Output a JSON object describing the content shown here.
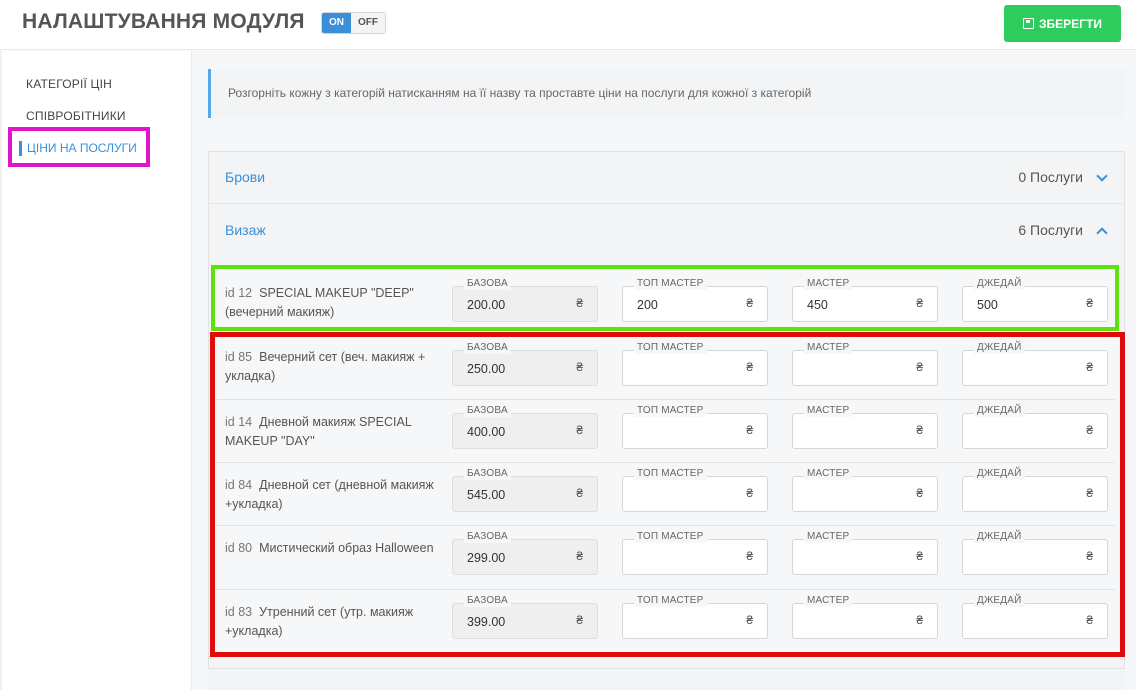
{
  "header": {
    "title": "НАЛАШТУВАННЯ МОДУЛЯ",
    "toggle_on": "ON",
    "toggle_off": "OFF",
    "save_label": "ЗБЕРЕГТИ"
  },
  "sidebar": {
    "items": [
      {
        "label": "КАТЕГОРІЇ ЦІН"
      },
      {
        "label": "СПІВРОБІТНИКИ"
      },
      {
        "label": "ЦІНИ НА ПОСЛУГИ",
        "active": true
      }
    ]
  },
  "info": "Розгорніть кожну з категорій натисканням на її назву та проставте ціни на послуги для кожної з категорій",
  "categories": [
    {
      "name": "Брови",
      "count": "0 Послуги",
      "expanded": false
    },
    {
      "name": "Визаж",
      "count": "6 Послуги",
      "expanded": true
    }
  ],
  "labels": {
    "base": "БАЗОВА",
    "top_master": "ТОП МАСТЕР",
    "master": "МАСТЕР",
    "jedi": "ДЖЕДАЙ",
    "currency": "₴"
  },
  "services": [
    {
      "id": "id 12",
      "name": "SPECIAL MAKEUP \"DEEP\" (вечерний макияж)",
      "base": "200.00",
      "top_master": "200",
      "master": "450",
      "jedi": "500"
    },
    {
      "id": "id 85",
      "name": "Вечерний сет (веч. макияж + укладка)",
      "base": "250.00",
      "top_master": "",
      "master": "",
      "jedi": ""
    },
    {
      "id": "id 14",
      "name": "Дневной макияж SPECIAL MAKEUP \"DAY\"",
      "base": "400.00",
      "top_master": "",
      "master": "",
      "jedi": ""
    },
    {
      "id": "id 84",
      "name": "Дневной сет (дневной макияж +укладка)",
      "base": "545.00",
      "top_master": "",
      "master": "",
      "jedi": ""
    },
    {
      "id": "id 80",
      "name": "Мистический образ Halloween",
      "base": "299.00",
      "top_master": "",
      "master": "",
      "jedi": ""
    },
    {
      "id": "id 83",
      "name": "Утренний сет (утр. макияж +укладка)",
      "base": "399.00",
      "top_master": "",
      "master": "",
      "jedi": ""
    }
  ],
  "colors": {
    "accent": "#3b8fd8",
    "save": "#2ecc5d",
    "highlight_magenta": "#e015c9",
    "highlight_green": "#5ee20f",
    "highlight_red": "#e10b0b"
  }
}
